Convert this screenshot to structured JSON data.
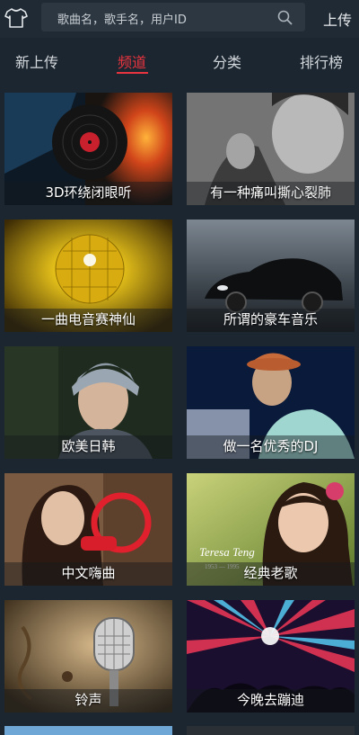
{
  "header": {
    "search_placeholder": "歌曲名，歌手名，用户ID",
    "upload_label": "上传",
    "icons": {
      "left": "tshirt-icon",
      "search": "search-icon"
    }
  },
  "tabs": [
    {
      "label": "新上传",
      "active": false
    },
    {
      "label": "频道",
      "active": true
    },
    {
      "label": "分类",
      "active": false
    },
    {
      "label": "排行榜",
      "active": false
    }
  ],
  "accent_color": "#e8343f",
  "channels": [
    {
      "label": "3D环绕闭眼听"
    },
    {
      "label": "有一种痛叫撕心裂肺"
    },
    {
      "label": "一曲电音赛神仙"
    },
    {
      "label": "所谓的豪车音乐"
    },
    {
      "label": "欧美日韩"
    },
    {
      "label": "做一名优秀的DJ"
    },
    {
      "label": "中文嗨曲"
    },
    {
      "label": "经典老歌"
    },
    {
      "label": "铃声"
    },
    {
      "label": "今晚去蹦迪"
    }
  ],
  "artwork_text": {
    "teresa": "Teresa Teng",
    "teresa_years": "1953 — 1995"
  }
}
